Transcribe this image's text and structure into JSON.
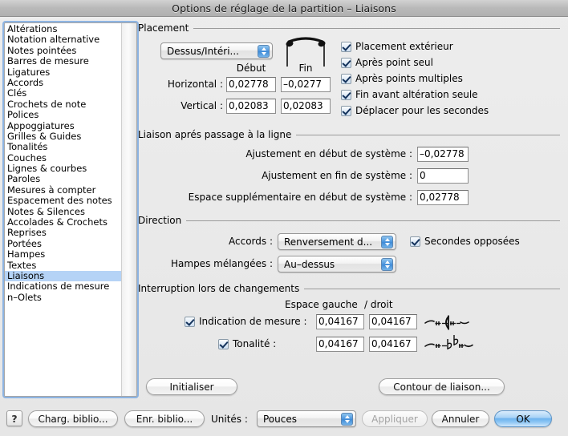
{
  "window": {
    "title": "Options de réglage de la partition – Liaisons"
  },
  "sidebar": {
    "items": [
      {
        "label": "Altérations",
        "selected": false
      },
      {
        "label": "Notation alternative",
        "selected": false
      },
      {
        "label": "Notes pointées",
        "selected": false
      },
      {
        "label": "Barres de mesure",
        "selected": false
      },
      {
        "label": "Ligatures",
        "selected": false
      },
      {
        "label": "Accords",
        "selected": false
      },
      {
        "label": "Clés",
        "selected": false
      },
      {
        "label": "Crochets de note",
        "selected": false
      },
      {
        "label": "Polices",
        "selected": false
      },
      {
        "label": "Appoggiatures",
        "selected": false
      },
      {
        "label": "Grilles & Guides",
        "selected": false
      },
      {
        "label": "Tonalités",
        "selected": false
      },
      {
        "label": "Couches",
        "selected": false
      },
      {
        "label": "Lignes & courbes",
        "selected": false
      },
      {
        "label": "Paroles",
        "selected": false
      },
      {
        "label": "Mesures à compter",
        "selected": false
      },
      {
        "label": "Espacement des notes",
        "selected": false
      },
      {
        "label": "Notes & Silences",
        "selected": false
      },
      {
        "label": "Accolades & Crochets",
        "selected": false
      },
      {
        "label": "Reprises",
        "selected": false
      },
      {
        "label": "Portées",
        "selected": false
      },
      {
        "label": "Hampes",
        "selected": false
      },
      {
        "label": "Textes",
        "selected": false
      },
      {
        "label": "Liaisons",
        "selected": true
      },
      {
        "label": "Indications de mesure",
        "selected": false
      },
      {
        "label": "n–Olets",
        "selected": false
      }
    ]
  },
  "placement": {
    "group_label": "Placement",
    "popup_value": "Dessus/Intéri...",
    "col_debut": "Début",
    "col_fin": "Fin",
    "horizontal_label": "Horizontal :",
    "horizontal_debut": "0,02778",
    "horizontal_fin": "–0,0277",
    "vertical_label": "Vertical :",
    "vertical_debut": "0,02083",
    "vertical_fin": "0,02083",
    "checkboxes": [
      {
        "label": "Placement extérieur",
        "checked": true
      },
      {
        "label": "Après point seul",
        "checked": true
      },
      {
        "label": "Après points multiples",
        "checked": true
      },
      {
        "label": "Fin avant altération seule",
        "checked": true
      },
      {
        "label": "Déplacer pour les secondes",
        "checked": true
      }
    ],
    "preview_icon": "slur-preview-icon"
  },
  "linebreak": {
    "group_label": "Liaison aprés passage à la ligne",
    "rows": [
      {
        "label": "Ajustement en début de système :",
        "value": "–0,02778"
      },
      {
        "label": "Ajustement en fin de système :",
        "value": "0"
      },
      {
        "label": "Espace supplémentaire en début de système :",
        "value": "0,02778"
      }
    ]
  },
  "direction": {
    "group_label": "Direction",
    "accords_label": "Accords :",
    "accords_value": "Renversement d...",
    "hampes_label": "Hampes mélangées :",
    "hampes_value": "Au–dessus",
    "secondes_label": "Secondes opposées",
    "secondes_checked": true
  },
  "interruption": {
    "group_label": "Interruption lors de changements",
    "col_header_left": "Espace gauche",
    "col_header_right": "/ droit",
    "rows": [
      {
        "label": "Indication de mesure :",
        "checked": true,
        "left": "0,04167",
        "right": "0,04167",
        "icon": "time-signature-glyph-icon"
      },
      {
        "label": "Tonalité :",
        "checked": true,
        "left": "0,04167",
        "right": "0,04167",
        "icon": "key-signature-glyph-icon"
      }
    ]
  },
  "actions": {
    "initialiser": "Initialiser",
    "contour": "Contour de liaison..."
  },
  "footer": {
    "help": "?",
    "charger_biblio": "Charg. biblio...",
    "enregistrer_biblio": "Enr. biblio...",
    "unites_label": "Unités :",
    "unites_value": "Pouces",
    "appliquer": "Appliquer",
    "appliquer_disabled": true,
    "annuler": "Annuler",
    "ok": "OK"
  },
  "colors": {
    "window_bg": "#ececec",
    "titlebar": "#b9b9b9",
    "selection": "#b5d3f6",
    "accent_blue": "#4c95dd",
    "default_button": "#6db3ee"
  }
}
